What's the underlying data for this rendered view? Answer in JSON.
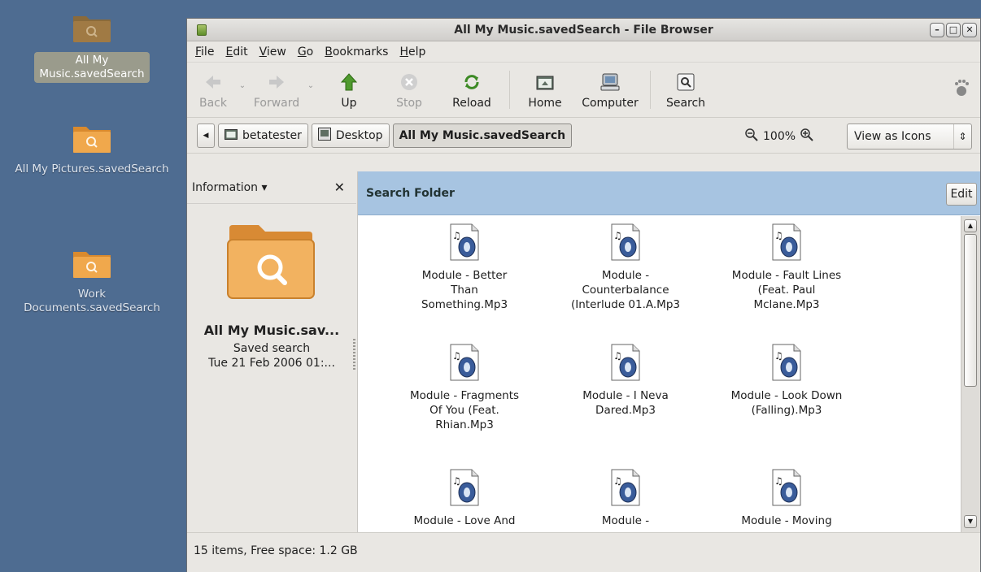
{
  "desktop": {
    "icons": [
      {
        "label": "All My Music.savedSearch",
        "selected": true
      },
      {
        "label": "All My Pictures.savedSearch",
        "selected": false
      },
      {
        "label": "Work Documents.savedSearch",
        "selected": false
      }
    ]
  },
  "window": {
    "title": "All My Music.savedSearch - File Browser",
    "controls": [
      "minimize",
      "maximize",
      "close"
    ]
  },
  "menubar": {
    "items": [
      {
        "label": "File",
        "mnemonic": "F",
        "rest": "ile"
      },
      {
        "label": "Edit",
        "mnemonic": "E",
        "rest": "dit"
      },
      {
        "label": "View",
        "mnemonic": "V",
        "rest": "iew"
      },
      {
        "label": "Go",
        "mnemonic": "G",
        "rest": "o"
      },
      {
        "label": "Bookmarks",
        "mnemonic": "B",
        "rest": "ookmarks"
      },
      {
        "label": "Help",
        "mnemonic": "H",
        "rest": "elp"
      }
    ]
  },
  "toolbar": {
    "back": "Back",
    "forward": "Forward",
    "up": "Up",
    "stop": "Stop",
    "reload": "Reload",
    "home": "Home",
    "computer": "Computer",
    "search": "Search"
  },
  "location": {
    "path": [
      "betatester",
      "Desktop",
      "All My Music.savedSearch"
    ],
    "zoom": "100%",
    "view_mode": "View as Icons"
  },
  "sidepane": {
    "selector": "Information",
    "name": "All My Music.sav...",
    "type": "Saved search",
    "date": "Tue 21 Feb 2006 01:..."
  },
  "searchbar": {
    "label": "Search Folder",
    "edit": "Edit"
  },
  "files": [
    {
      "name": "Module - Better Than Something.Mp3",
      "lines": [
        "Module - Better",
        "Than",
        "Something.Mp3"
      ]
    },
    {
      "name": "Module - Counterbalance (Interlude 01.A.Mp3",
      "lines": [
        "Module -",
        "Counterbalance",
        "(Interlude 01.A.Mp3"
      ]
    },
    {
      "name": "Module - Fault Lines (Feat. Paul Mclane.Mp3",
      "lines": [
        "Module - Fault Lines",
        "(Feat. Paul",
        "Mclane.Mp3"
      ]
    },
    {
      "name": "Module - Fragments Of You (Feat. Rhian.Mp3",
      "lines": [
        "Module - Fragments",
        "Of You (Feat.",
        "Rhian.Mp3"
      ]
    },
    {
      "name": "Module - I Neva Dared.Mp3",
      "lines": [
        "Module - I Neva",
        "Dared.Mp3"
      ]
    },
    {
      "name": "Module - Look Down (Falling).Mp3",
      "lines": [
        "Module - Look Down",
        "(Falling).Mp3"
      ]
    },
    {
      "name": "Module - Love And",
      "lines": [
        "Module - Love And"
      ]
    },
    {
      "name": "Module -",
      "lines": [
        "Module -"
      ]
    },
    {
      "name": "Module - Moving",
      "lines": [
        "Module - Moving"
      ]
    }
  ],
  "status": "15 items, Free space: 1.2 GB",
  "colors": {
    "desktop": "#4e6c91",
    "search_bar": "#a7c4e1",
    "folder": "#e8a04a"
  }
}
